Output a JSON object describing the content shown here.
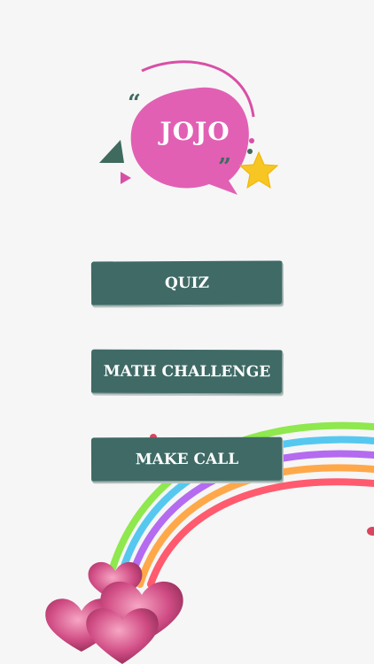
{
  "logo": {
    "title": "JOJO",
    "quote_open": "“",
    "quote_close": "”"
  },
  "menu": {
    "quiz_label": "QUIZ",
    "math_label": "MATH CHALLENGE",
    "call_label": "MAKE CALL"
  },
  "colors": {
    "bubble": "#e160b4",
    "button": "#3f6a66",
    "star": "#f7c623",
    "rainbow": [
      "#ff5a6e",
      "#ffa84a",
      "#b46bf0",
      "#56c8f0",
      "#8ee84e"
    ],
    "hearts": "#c9487a"
  }
}
